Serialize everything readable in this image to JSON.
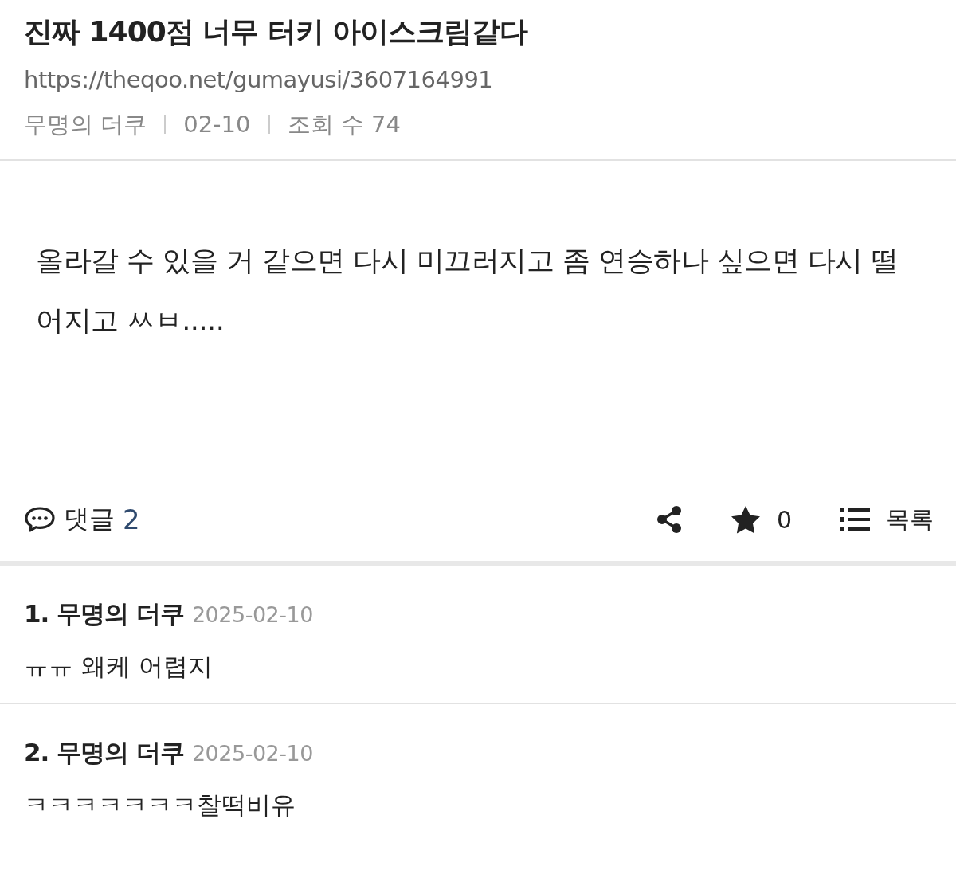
{
  "post": {
    "title": "진짜 1400점 너무 터키 아이스크림같다",
    "url": "https://theqoo.net/gumayusi/3607164991",
    "meta": [
      "무명의 더쿠",
      "02-10",
      "조회 수 74"
    ],
    "body": "올라갈 수 있을 거 같으면 다시 미끄러지고 좀 연승하나 싶으면 다시 떨어지고 ㅆㅂ....."
  },
  "actions": {
    "comments_label": "댓글",
    "comments_count": "2",
    "star_count": "0",
    "list_label": "목록"
  },
  "comments": [
    {
      "number": "1.",
      "author": "무명의 더쿠",
      "date": "2025-02-10",
      "text": "ㅠㅠ 왜케 어렵지"
    },
    {
      "number": "2.",
      "author": "무명의 더쿠",
      "date": "2025-02-10",
      "text": "ㅋㅋㅋㅋㅋㅋㅋ찰떡비유"
    }
  ]
}
